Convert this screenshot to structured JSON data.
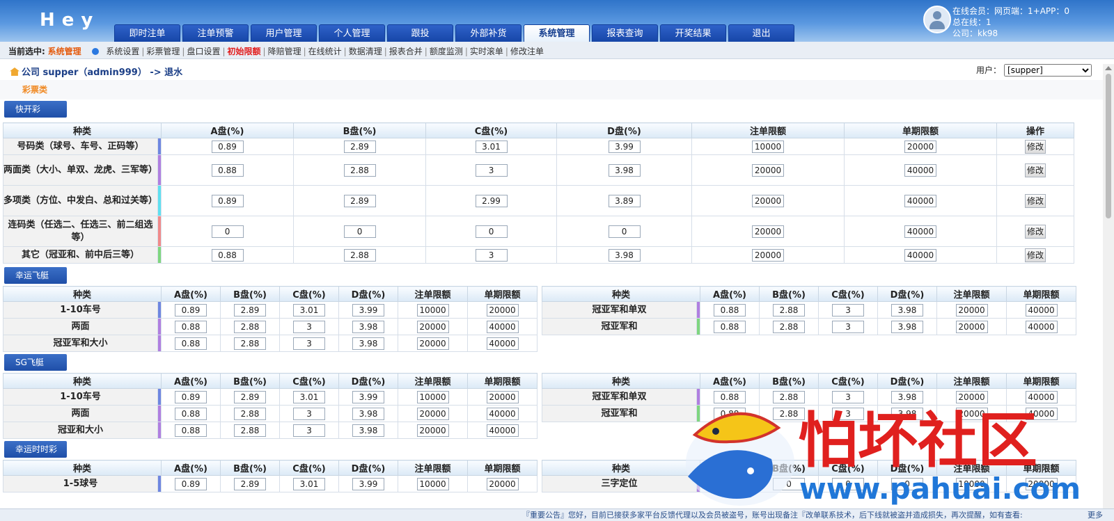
{
  "header": {
    "logo": "Hey",
    "online_members": "在线会员：网页端：1+APP：0",
    "total_online": "总在线：1",
    "company": "公司：kk98"
  },
  "nav": [
    "即时注单",
    "注单预警",
    "用户管理",
    "个人管理",
    "跟投",
    "外部补货",
    "系统管理",
    "报表查询",
    "开奖结果",
    "退出"
  ],
  "subnav": {
    "current_label": "当前选中:",
    "current_value": "系统管理",
    "items": [
      "系统设置",
      "彩票管理",
      "盘口设置",
      "初始限额",
      "降赔管理",
      "在线统计",
      "数据清理",
      "报表合并",
      "额度监测",
      "实时滚单",
      "修改注单"
    ]
  },
  "breadcrumb": "公司 supper（admin999） -> 退水",
  "user_select": {
    "label": "用户：",
    "value": "[supper]"
  },
  "category": "彩票类",
  "quick": {
    "title": "快开彩",
    "headers": [
      "种类",
      "A盘(%)",
      "B盘(%)",
      "C盘(%)",
      "D盘(%)",
      "注单限额",
      "单期限额",
      "操作"
    ],
    "rows": [
      {
        "name": "号码类（球号、车号、正码等）",
        "vals": [
          "0.89",
          "2.89",
          "3.01",
          "3.99",
          "10000",
          "20000"
        ],
        "bar": "#6f86e0",
        "action": "修改"
      },
      {
        "name": "两面类（大小、单双、龙虎、三军等）",
        "vals": [
          "0.88",
          "2.88",
          "3",
          "3.98",
          "20000",
          "40000"
        ],
        "bar": "#b07fe0",
        "action": "修改"
      },
      {
        "name": "多项类（方位、中发白、总和过关等）",
        "vals": [
          "0.89",
          "2.89",
          "2.99",
          "3.89",
          "20000",
          "40000"
        ],
        "bar": "#5fe0f0",
        "action": "修改"
      },
      {
        "name": "连码类（任选二、任选三、前二组选等）",
        "vals": [
          "0",
          "0",
          "0",
          "0",
          "20000",
          "40000"
        ],
        "bar": "#f08a8a",
        "action": "修改"
      },
      {
        "name": "其它（冠亚和、前中后三等）",
        "vals": [
          "0.88",
          "2.88",
          "3",
          "3.98",
          "20000",
          "40000"
        ],
        "bar": "#7fd67f",
        "action": "修改"
      }
    ]
  },
  "small_headers": [
    "种类",
    "A盘(%)",
    "B盘(%)",
    "C盘(%)",
    "D盘(%)",
    "注单限额",
    "单期限额"
  ],
  "sections": [
    {
      "title": "幸运飞艇",
      "left": [
        {
          "name": "1-10车号",
          "vals": [
            "0.89",
            "2.89",
            "3.01",
            "3.99",
            "10000",
            "20000"
          ],
          "bar": "#6f86e0"
        },
        {
          "name": "两面",
          "vals": [
            "0.88",
            "2.88",
            "3",
            "3.98",
            "20000",
            "40000"
          ],
          "bar": "#b07fe0"
        },
        {
          "name": "冠亚军和大小",
          "vals": [
            "0.88",
            "2.88",
            "3",
            "3.98",
            "20000",
            "40000"
          ],
          "bar": "#b07fe0"
        }
      ],
      "right": [
        {
          "name": "冠亚军和单双",
          "vals": [
            "0.88",
            "2.88",
            "3",
            "3.98",
            "20000",
            "40000"
          ],
          "bar": "#b07fe0"
        },
        {
          "name": "冠亚军和",
          "vals": [
            "0.88",
            "2.88",
            "3",
            "3.98",
            "20000",
            "40000"
          ],
          "bar": "#7fd67f"
        }
      ]
    },
    {
      "title": "SG飞艇",
      "left": [
        {
          "name": "1-10车号",
          "vals": [
            "0.89",
            "2.89",
            "3.01",
            "3.99",
            "10000",
            "20000"
          ],
          "bar": "#6f86e0"
        },
        {
          "name": "两面",
          "vals": [
            "0.88",
            "2.88",
            "3",
            "3.98",
            "20000",
            "40000"
          ],
          "bar": "#b07fe0"
        },
        {
          "name": "冠亚和大小",
          "vals": [
            "0.88",
            "2.88",
            "3",
            "3.98",
            "20000",
            "40000"
          ],
          "bar": "#b07fe0"
        }
      ],
      "right": [
        {
          "name": "冠亚军和单双",
          "vals": [
            "0.88",
            "2.88",
            "3",
            "3.98",
            "20000",
            "40000"
          ],
          "bar": "#b07fe0"
        },
        {
          "name": "冠亚军和",
          "vals": [
            "0.88",
            "2.88",
            "3",
            "3.98",
            "20000",
            "40000"
          ],
          "bar": "#7fd67f"
        }
      ]
    },
    {
      "title": "幸运时时彩",
      "left": [
        {
          "name": "1-5球号",
          "vals": [
            "0.89",
            "2.89",
            "3.01",
            "3.99",
            "10000",
            "20000"
          ],
          "bar": "#6f86e0"
        }
      ],
      "right": [
        {
          "name": "三字定位",
          "vals": [
            "0",
            "0",
            "0",
            "0",
            "10000",
            "20000"
          ],
          "bar": "#b07fe0"
        }
      ]
    }
  ],
  "footer": {
    "notice": "『重要公告』您好，目前已接获多家平台反馈代理以及会员被盗号，账号出现备注『改单联系技术，后下线就被盗并造成损失，再次提醒，如有查看:",
    "more": "更多"
  },
  "watermark": {
    "text": "怕坏社区",
    "url": "www.pahuai.com"
  }
}
